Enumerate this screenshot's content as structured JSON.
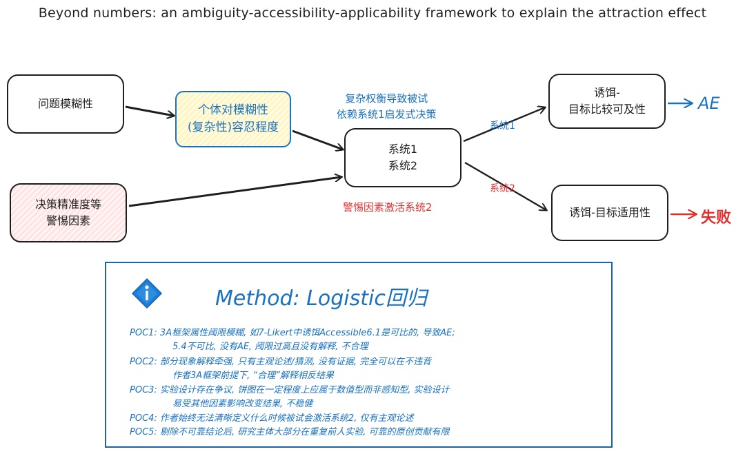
{
  "title": "Beyond numbers: an ambiguity-accessibility-applicability framework to explain the attraction effect",
  "nodes": {
    "ambiguity": [
      "问题模糊性"
    ],
    "tolerance": [
      "个体对模糊性",
      "(复杂性)容忍程度"
    ],
    "vigilance": [
      "决策精准度等",
      "警惕因素"
    ],
    "systems": [
      "系统1",
      "系统2"
    ],
    "accessibility": [
      "诱饵-",
      "目标比较可及性"
    ],
    "applicability": [
      "诱饵-目标适用性"
    ]
  },
  "labels": {
    "tradeoff": [
      "复杂权衡导致被试",
      "依赖系统1启发式决策"
    ],
    "vigilance_activates": "警惕因素激活系统2",
    "edge_system1": "系统1",
    "edge_system2": "系统2",
    "outcome_ae": "AE",
    "outcome_fail": "失败"
  },
  "method": {
    "title": "Method: Logistic回归",
    "pocs": [
      {
        "line1": "POC1: 3A框架属性阈限模糊, 如7-Likert中诱饵Accessible6.1是可比的, 导致AE;",
        "line2": "5.4不可比, 没有AE, 阈限过高且没有解释, 不合理"
      },
      {
        "line1": "POC2: 部分现象解释牵强, 只有主观论述/猜测, 没有证据, 完全可以在不违背",
        "line2": "作者3A框架前提下, “合理”解释相反结果"
      },
      {
        "line1": "POC3: 实验设计存在争议, 饼图在一定程度上应属于数值型而非感知型, 实验设计",
        "line2": "易受其他因素影响改变结果, 不稳健"
      },
      {
        "line1": "POC4: 作者始终无法清晰定义什么时候被试会激活系统2, 仅有主观论述",
        "line2": ""
      },
      {
        "line1": "POC5: 剔除不可靠结论后, 研究主体大部分在重复前人实验, 可靠的原创贡献有限",
        "line2": ""
      }
    ]
  },
  "colors": {
    "blue": "#1971c2",
    "red": "#e03131",
    "stroke": "#1e1e1e"
  }
}
